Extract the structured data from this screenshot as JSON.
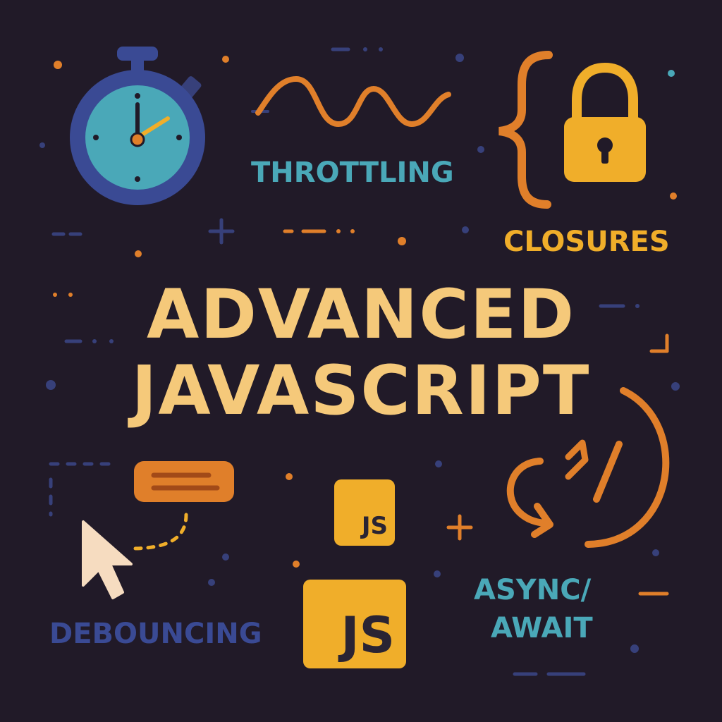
{
  "title": {
    "line1": "ADVANCED",
    "line2": "JAVASCRIPT"
  },
  "labels": {
    "throttling": "THROTTLING",
    "closures": "CLOSURES",
    "debouncing": "DEBOUNCING",
    "async_line1": "ASYNC/",
    "async_line2": "AWAIT"
  },
  "badges": {
    "js_small": "JS",
    "js_large": "JS"
  },
  "colors": {
    "background": "#211a28",
    "title": "#f5c97a",
    "teal": "#4aa8b8",
    "orange": "#e07f2a",
    "yellow": "#f0ae2a",
    "navy": "#3a4a94",
    "cursor": "#f6dcc0",
    "dots_blue": "#37407a",
    "dots_orange": "#e07f2a"
  },
  "icons": {
    "stopwatch": "stopwatch-icon",
    "wave": "wave-icon",
    "brace": "curly-brace-icon",
    "lock": "padlock-icon",
    "message": "message-bubble-icon",
    "cursor": "mouse-cursor-icon",
    "async": "async-arrows-icon"
  }
}
